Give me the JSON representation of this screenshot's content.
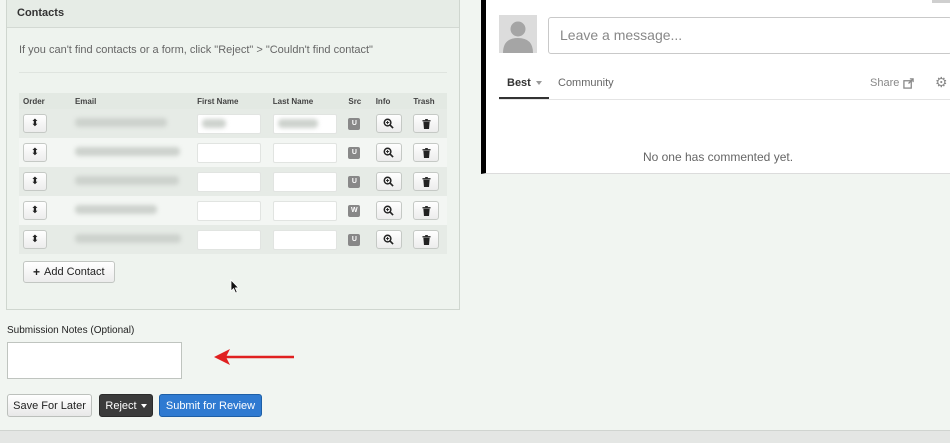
{
  "contacts_panel": {
    "title": "Contacts",
    "hint": "If you can't find contacts or a form, click \"Reject\" > \"Couldn't find contact\"",
    "columns": [
      "Order",
      "Email",
      "First Name",
      "Last Name",
      "Src",
      "Info",
      "Trash"
    ],
    "rows": [
      {
        "src": "U"
      },
      {
        "src": "U"
      },
      {
        "src": "U"
      },
      {
        "src": "W"
      },
      {
        "src": "U"
      }
    ],
    "add_contact_label": "Add Contact"
  },
  "notes": {
    "label": "Submission Notes (Optional)",
    "value": ""
  },
  "actions": {
    "save_label": "Save For Later",
    "reject_label": "Reject",
    "submit_label": "Submit for Review"
  },
  "comments": {
    "placeholder": "Leave a message...",
    "tabs": [
      "Best",
      "Community"
    ],
    "share_label": "Share",
    "empty_text": "No one has commented yet."
  },
  "colors": {
    "submit_button": "#2f7ad1",
    "reject_button": "#3b3b3b",
    "annotation_arrow": "#e02020"
  },
  "icons": {
    "order": "sort-updown-icon",
    "info": "magnify-plus-icon",
    "trash": "trash-icon",
    "add": "plus-icon",
    "share": "share-icon",
    "settings": "gear-icon"
  }
}
